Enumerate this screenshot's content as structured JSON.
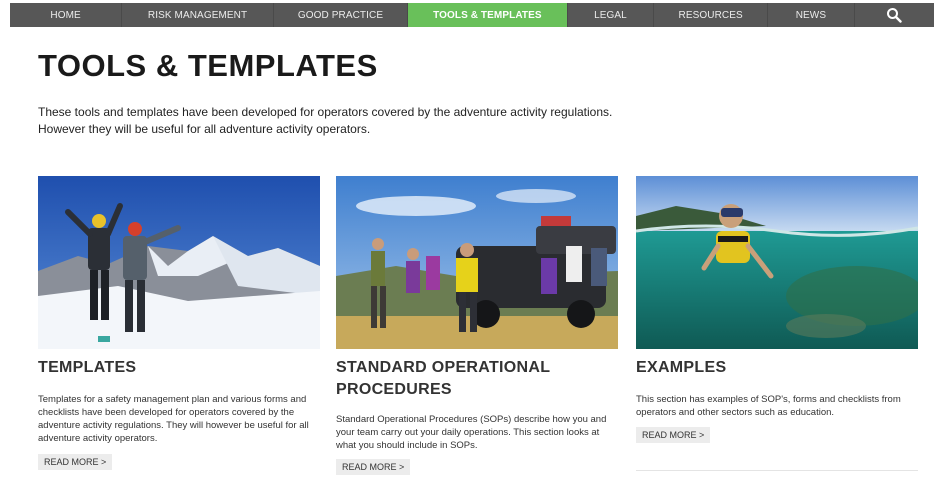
{
  "nav": {
    "items": [
      {
        "label": "HOME"
      },
      {
        "label": "RISK MANAGEMENT"
      },
      {
        "label": "GOOD PRACTICE"
      },
      {
        "label": "TOOLS & TEMPLATES",
        "active": true
      },
      {
        "label": "LEGAL"
      },
      {
        "label": "RESOURCES"
      },
      {
        "label": "NEWS"
      }
    ],
    "search_icon": "search-icon",
    "active_color": "#69c05a",
    "bar_color": "#575757"
  },
  "page": {
    "title": "TOOLS & TEMPLATES",
    "intro": "These tools and templates have been developed for operators covered by the adventure activity regulations. However they will be useful for all adventure activity operators."
  },
  "cards": [
    {
      "title": "TEMPLATES",
      "description": "Templates for a safety management plan and various forms and checklists have been developed for operators covered by the adventure activity regulations. They will however be useful for all adventure activity operators.",
      "read_more": "READ MORE >",
      "image": "climbers-on-mountain-summit"
    },
    {
      "title": "STANDARD OPERATIONAL PROCEDURES",
      "description": "Standard Operational Procedures (SOPs) describe how you and your team carry out your daily operations. This section looks at what you should include in SOPs.",
      "read_more": "READ MORE >",
      "image": "group-cheering-by-4wd-vehicle"
    },
    {
      "title": "EXAMPLES",
      "description": "This section has examples of SOP's, forms and checklists from operators and other sectors such as education.",
      "read_more": "READ MORE >",
      "image": "snorkeler-in-lake"
    }
  ]
}
